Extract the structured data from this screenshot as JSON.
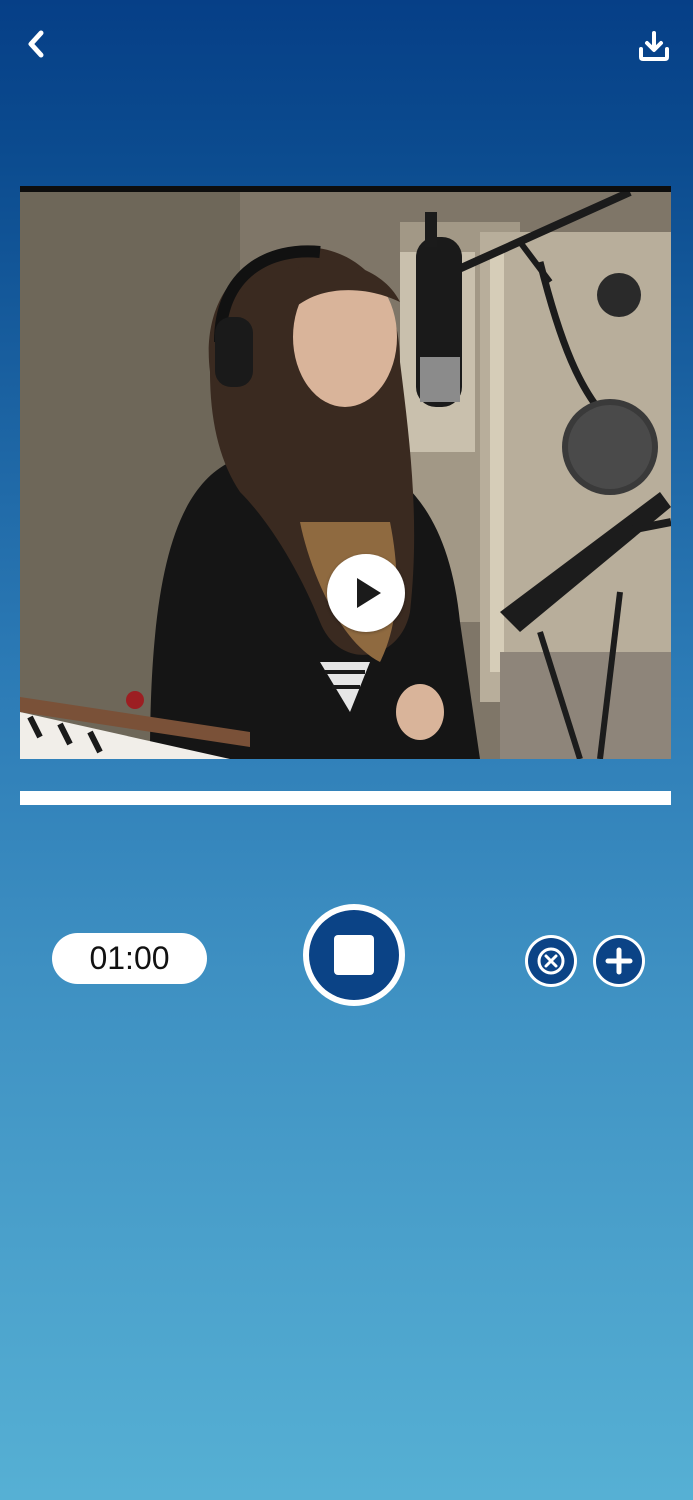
{
  "header": {
    "back_icon": "chevron-left-icon",
    "download_icon": "download-icon"
  },
  "player": {
    "play_icon": "play-icon",
    "scene": "woman-singing-into-studio-microphone"
  },
  "progress": {
    "value": 1.0
  },
  "controls": {
    "timer": "01:00",
    "record_icon": "stop-icon",
    "cancel_icon": "close-circle-icon",
    "add_icon": "plus-icon"
  },
  "colors": {
    "accent": "#0b4386",
    "gradient_top": "#063f87",
    "gradient_bottom": "#56b0d4"
  }
}
